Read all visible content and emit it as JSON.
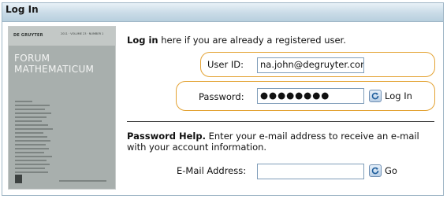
{
  "header": {
    "title": "Log In"
  },
  "cover": {
    "publisher": "DE GRUYTER",
    "issue": "2011 · VOLUME 23 · NUMBER 1",
    "title_line1": "FORUM",
    "title_line2": "MATHEMATICUM"
  },
  "login": {
    "intro_bold": "Log in",
    "intro_rest": " here if you are already a registered user.",
    "user_label": "User ID:",
    "user_value": "na.john@degruyter.com",
    "password_label": "Password:",
    "password_value": "●●●●●●●●",
    "login_button": "Log In"
  },
  "help": {
    "title": "Password Help.",
    "text": " Enter your e-mail address to receive an e-mail with your account information.",
    "email_label": "E-Mail Address:",
    "email_value": "",
    "go_button": "Go"
  },
  "colors": {
    "highlight": "#e3a232",
    "header": "#c9dbe7"
  }
}
